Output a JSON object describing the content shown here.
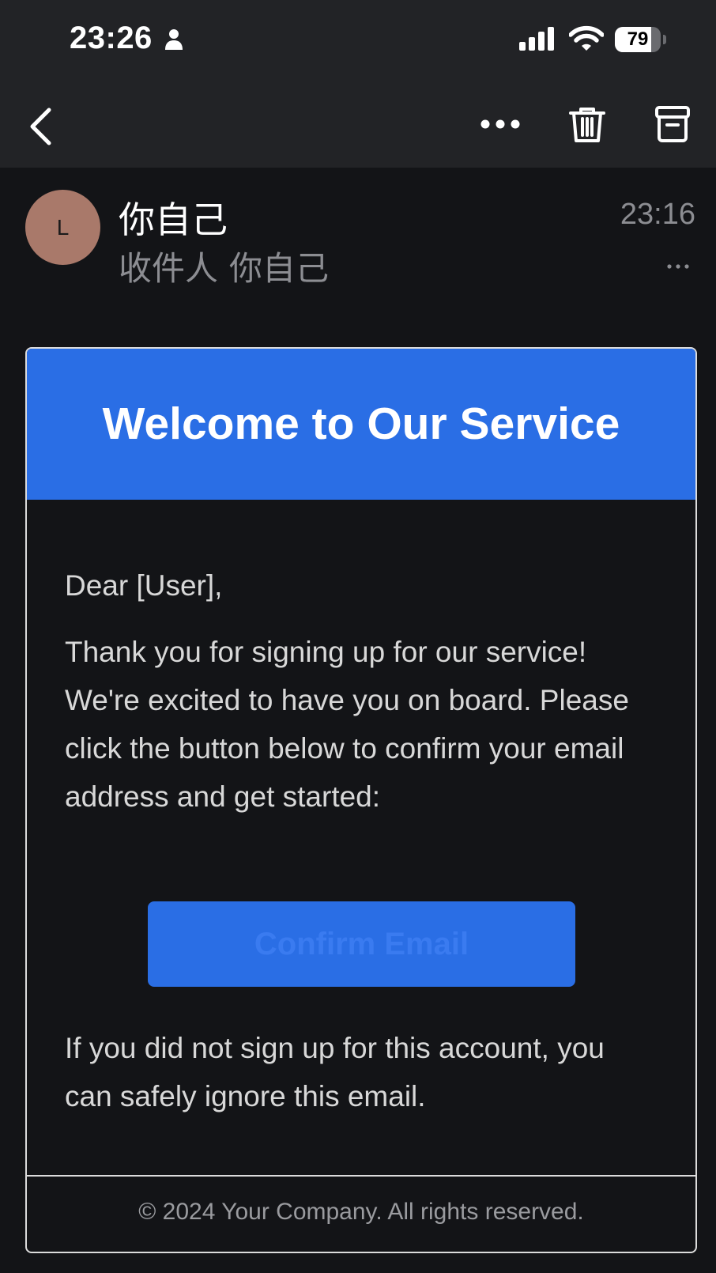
{
  "status_bar": {
    "time": "23:26",
    "battery_percent": "79",
    "battery_level": 0.79
  },
  "toolbar": {
    "back_icon": "chevron-left-icon",
    "more_icon": "more-horizontal-icon",
    "trash_icon": "trash-icon",
    "archive_icon": "archive-icon"
  },
  "message_header": {
    "avatar_initial": "L",
    "avatar_color": "#a9796a",
    "sender": "你自己",
    "recipient_prefix": "收件人",
    "recipient": "你自己",
    "time": "23:16"
  },
  "email": {
    "banner_color": "#2a6ee5",
    "title": "Welcome to Our Service",
    "greeting": "Dear [User],",
    "paragraph1": "Thank you for signing up for our service! We're excited to have you on board. Please click the button below to confirm your email address and get started:",
    "button_label": "Confirm Email",
    "paragraph2": "If you did not sign up for this account, you can safely ignore this email.",
    "footer": "© 2024 Your Company. All rights reserved."
  }
}
